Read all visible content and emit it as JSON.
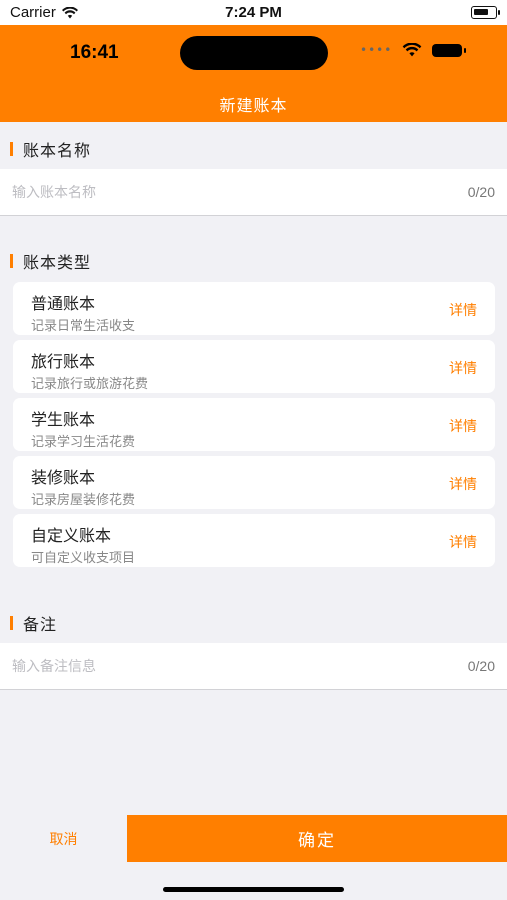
{
  "sim_status": {
    "carrier": "Carrier",
    "time": "7:24 PM",
    "wifi_icon": "wifi-icon",
    "battery_icon": "battery-icon"
  },
  "device_status": {
    "time": "16:41",
    "signal_icon": "cellular-signal-icon",
    "wifi_icon": "wifi-icon",
    "battery_icon": "battery-icon"
  },
  "header": {
    "title": "新建账本"
  },
  "name_section": {
    "label": "账本名称",
    "placeholder": "输入账本名称",
    "value": "",
    "counter": "0/20"
  },
  "type_section": {
    "label": "账本类型",
    "items": [
      {
        "name": "普通账本",
        "desc": "记录日常生活收支",
        "detail": "详情"
      },
      {
        "name": "旅行账本",
        "desc": "记录旅行或旅游花费",
        "detail": "详情"
      },
      {
        "name": "学生账本",
        "desc": "记录学习生活花费",
        "detail": "详情"
      },
      {
        "name": "装修账本",
        "desc": "记录房屋装修花费",
        "detail": "详情"
      },
      {
        "name": "自定义账本",
        "desc": "可自定义收支项目",
        "detail": "详情"
      }
    ]
  },
  "note_section": {
    "label": "备注",
    "placeholder": "输入备注信息",
    "value": "",
    "counter": "0/20"
  },
  "footer": {
    "cancel_label": "取消",
    "confirm_label": "确定"
  },
  "colors": {
    "accent": "#ff7f00",
    "background": "#f1f1f5",
    "card": "#ffffff"
  }
}
